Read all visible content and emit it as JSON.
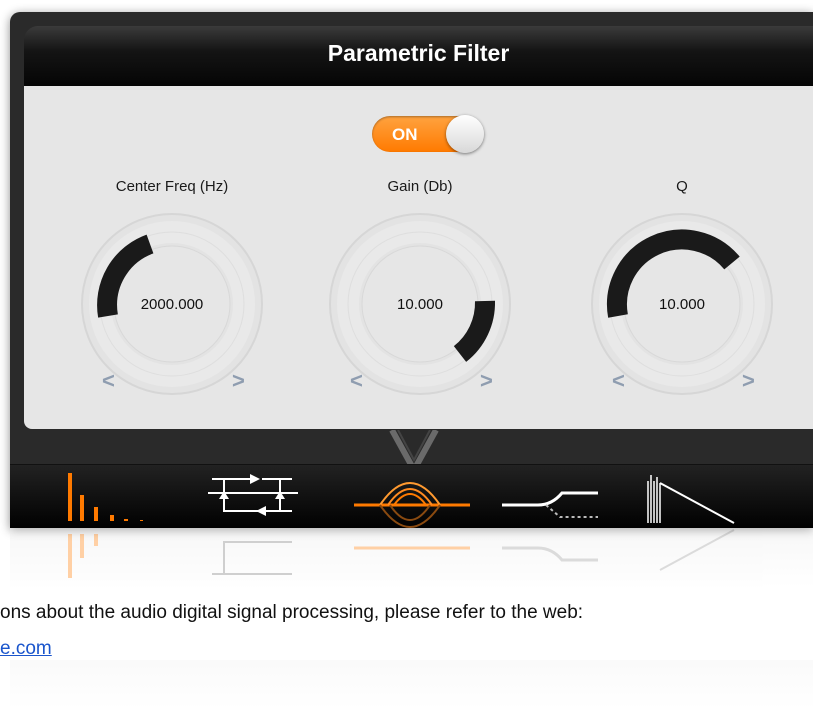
{
  "window": {
    "title": "Parametric Filter"
  },
  "toggle": {
    "label": "ON",
    "state": "on"
  },
  "knobs": [
    {
      "label": "Center Freq (Hz)",
      "value": "2000.000",
      "prev": "<",
      "next": ">"
    },
    {
      "label": "Gain (Db)",
      "value": "10.000",
      "prev": "<",
      "next": ">"
    },
    {
      "label": "Q",
      "value": "10.000",
      "prev": "<",
      "next": ">"
    }
  ],
  "dock": {
    "items": [
      {
        "name": "equalizer-bars-icon",
        "active": false
      },
      {
        "name": "rectifier-circuit-icon",
        "active": false
      },
      {
        "name": "parametric-peak-icon",
        "active": true
      },
      {
        "name": "shelf-filter-icon",
        "active": false
      },
      {
        "name": "ramp-waveform-icon",
        "active": false
      }
    ]
  },
  "colors": {
    "accent": "#ff7a00",
    "panel": "#e6e6e6",
    "arc": "#1a1a1a",
    "chevron": "#8f9db0"
  },
  "footer": {
    "text": "ons about the audio digital signal processing, please refer to the web:",
    "link": "e.com"
  }
}
